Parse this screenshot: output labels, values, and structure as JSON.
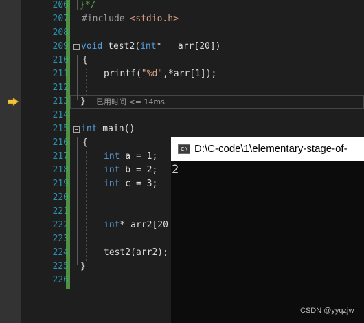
{
  "editor": {
    "line_numbers": [
      "206",
      "207",
      "208",
      "209",
      "210",
      "211",
      "212",
      "213",
      "214",
      "215",
      "216",
      "217",
      "218",
      "219",
      "220",
      "221",
      "222",
      "223",
      "224",
      "225",
      "226"
    ],
    "code": {
      "l206": "}*/",
      "l207_kw": "#include",
      "l207_hdr": "<stdio.h>",
      "l209_kw": "void",
      "l209_fn": " test2(",
      "l209_kw2": "int",
      "l209_rest": "*   arr[20])",
      "l210": "{",
      "l211_fn": "printf(",
      "l211_str": "\"%d\"",
      "l211_rest": ",*arr[1]);",
      "l213": "}",
      "l215_kw": "int",
      "l215_rest": " main()",
      "l216": "{",
      "l217_kw": "int",
      "l217_rest": " a = 1;",
      "l218_kw": "int",
      "l218_rest": " b = 2;",
      "l219_kw": "int",
      "l219_rest": " c = 3;",
      "l222_kw": "int",
      "l222_rest": "* arr2[20",
      "l224": "test2(arr2);",
      "l225": "}"
    },
    "perf_tip": "已用时间 <= 14ms",
    "current_line": "213"
  },
  "console": {
    "icon_text": "C:\\",
    "title": "D:\\C-code\\1\\elementary-stage-of-",
    "output": "2"
  },
  "watermark": "CSDN @yyqzjw",
  "colors": {
    "background": "#1e1e1e",
    "keyword": "#569cd6",
    "string": "#d69d85",
    "line_number": "#2b91af",
    "change_bar": "#57a64a",
    "arrow": "#f5c33b"
  },
  "icons": {
    "execution_arrow": "execution-pointer-icon",
    "console": "console-app-icon"
  }
}
